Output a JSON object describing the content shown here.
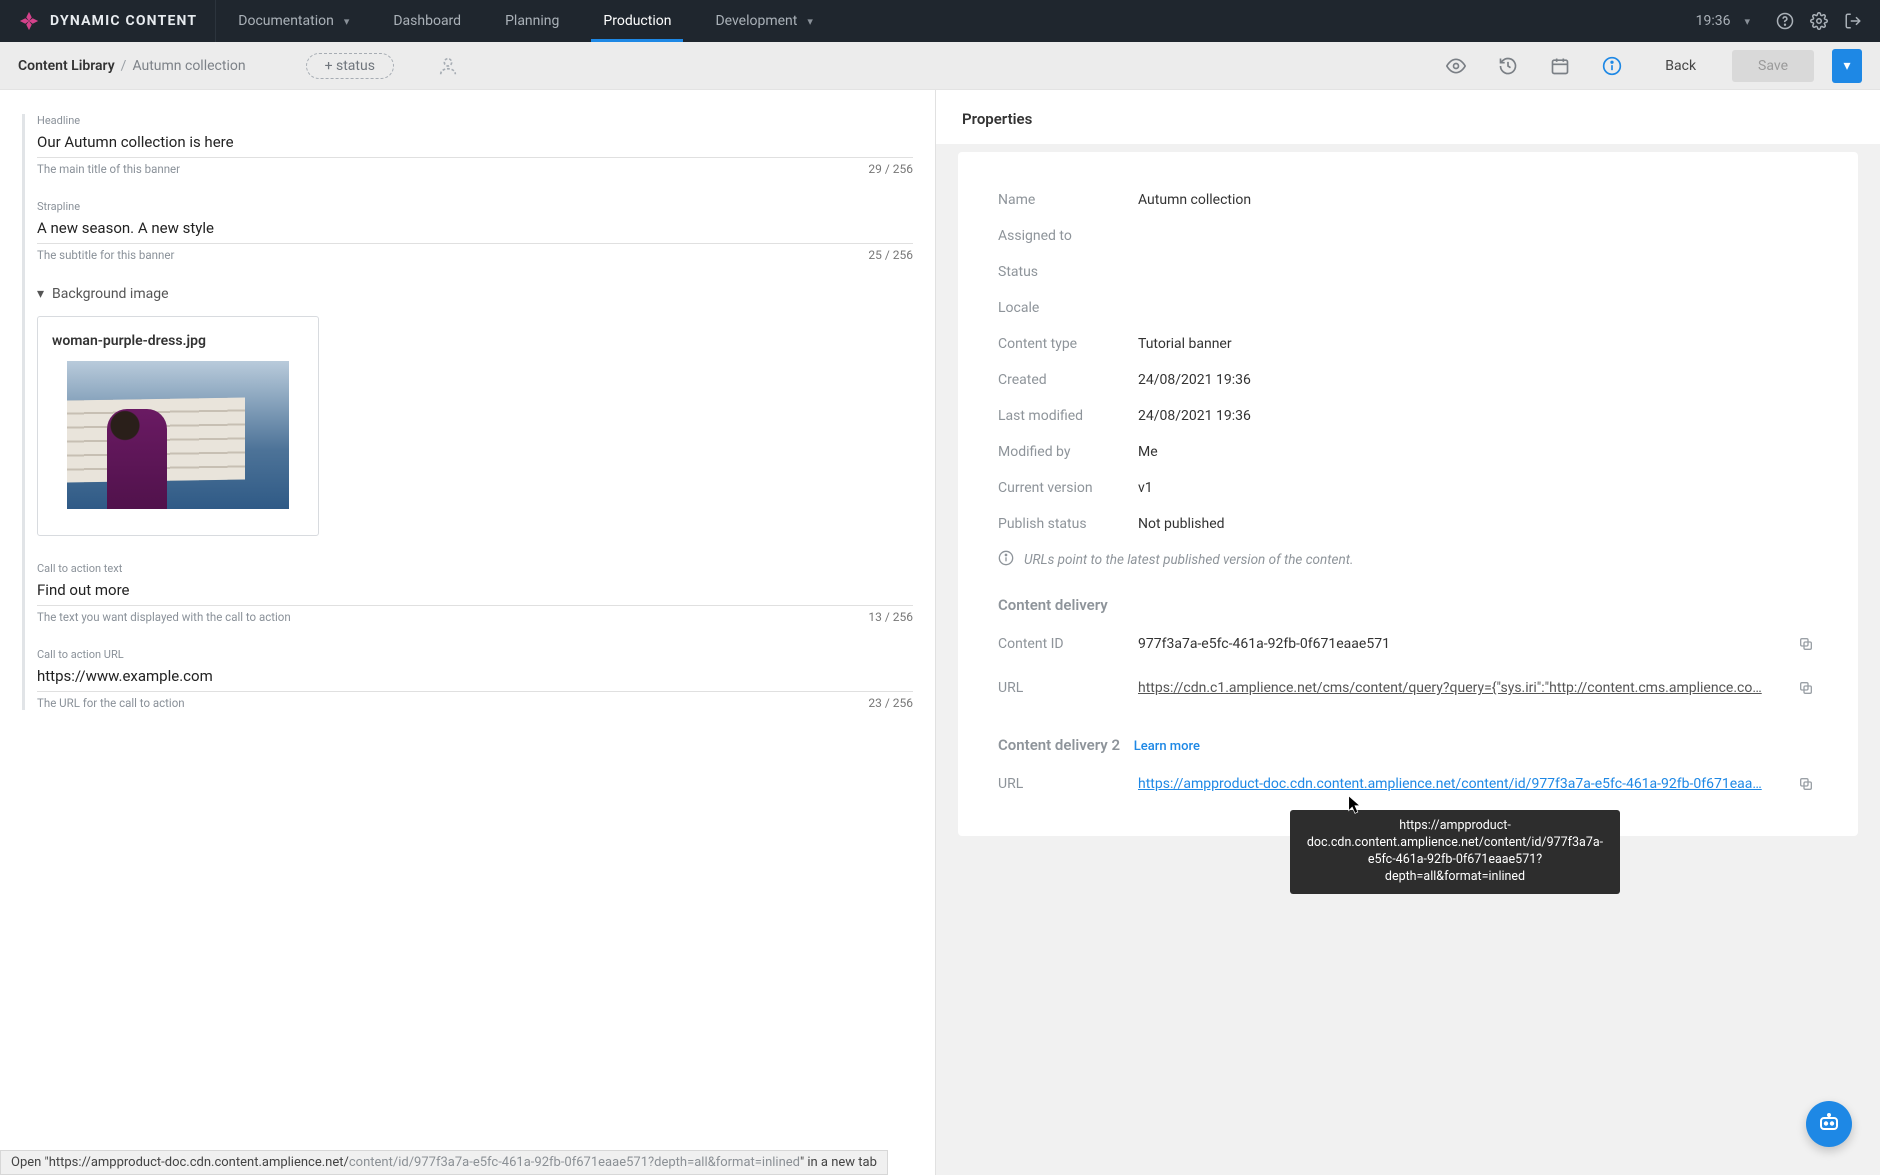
{
  "brand": {
    "name": "DYNAMIC CONTENT"
  },
  "topnav": {
    "documentation": "Documentation",
    "items": [
      "Dashboard",
      "Planning",
      "Production",
      "Development"
    ],
    "active": "Production",
    "clock": "19:36"
  },
  "subheader": {
    "crumb_root": "Content Library",
    "crumb_leaf": "Autumn collection",
    "status_chip": "+ status",
    "back": "Back",
    "save": "Save"
  },
  "form": {
    "headline": {
      "label": "Headline",
      "value": "Our Autumn collection is here",
      "help": "The main title of this banner",
      "count": "29 / 256"
    },
    "strapline": {
      "label": "Strapline",
      "value": "A new season. A new style",
      "help": "The subtitle for this banner",
      "count": "25 / 256"
    },
    "bg_section": "Background image",
    "bg_image_name": "woman-purple-dress.jpg",
    "cta_text": {
      "label": "Call to action text",
      "value": "Find out more",
      "help": "The text you want displayed with the call to action",
      "count": "13 / 256"
    },
    "cta_url": {
      "label": "Call to action URL",
      "value": "https://www.example.com",
      "help": "The URL for the call to action",
      "count": "23 / 256"
    }
  },
  "properties": {
    "title": "Properties",
    "rows": {
      "name_k": "Name",
      "name_v": "Autumn collection",
      "assigned_k": "Assigned to",
      "assigned_v": "",
      "status_k": "Status",
      "status_v": "",
      "locale_k": "Locale",
      "locale_v": "",
      "ctype_k": "Content type",
      "ctype_v": "Tutorial banner",
      "created_k": "Created",
      "created_v": "24/08/2021 19:36",
      "modified_k": "Last modified",
      "modified_v": "24/08/2021 19:36",
      "modby_k": "Modified by",
      "modby_v": "Me",
      "version_k": "Current version",
      "version_v": "v1",
      "pub_k": "Publish status",
      "pub_v": "Not published"
    },
    "note": "URLs point to the latest published version of the content.",
    "cd1_title": "Content delivery",
    "cd1_id_k": "Content ID",
    "cd1_id_v": "977f3a7a-e5fc-461a-92fb-0f671eaae571",
    "cd1_url_k": "URL",
    "cd1_url_v": "https://cdn.c1.amplience.net/cms/content/query?query={\"sys.iri\":\"http://content.cms.amplience.co…",
    "cd2_title": "Content delivery 2",
    "cd2_learn": "Learn more",
    "cd2_url_k": "URL",
    "cd2_url_v": "https://ampproduct-doc.cdn.content.amplience.net/content/id/977f3a7a-e5fc-461a-92fb-0f671eaa…"
  },
  "tooltip": "https://ampproduct-doc.cdn.content.amplience.net/content/id/977f3a7a-e5fc-461a-92fb-0f671eaae571?depth=all&format=inlined",
  "statusbar": {
    "prefix": "Open \"https://ampproduct-doc.cdn.content.amplience.net/",
    "mid": "content/id/977f3a7a-e5fc-461a-92fb-0f671eaae571?depth=all&format=inlined",
    "suffix": "\" in a new tab"
  }
}
